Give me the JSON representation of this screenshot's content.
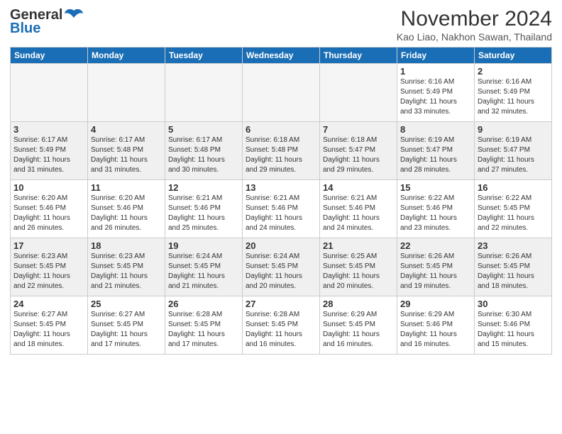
{
  "header": {
    "logo_general": "General",
    "logo_blue": "Blue",
    "month_year": "November 2024",
    "location": "Kao Liao, Nakhon Sawan, Thailand"
  },
  "weekdays": [
    "Sunday",
    "Monday",
    "Tuesday",
    "Wednesday",
    "Thursday",
    "Friday",
    "Saturday"
  ],
  "weeks": [
    {
      "shaded": false,
      "days": [
        {
          "num": "",
          "info": ""
        },
        {
          "num": "",
          "info": ""
        },
        {
          "num": "",
          "info": ""
        },
        {
          "num": "",
          "info": ""
        },
        {
          "num": "",
          "info": ""
        },
        {
          "num": "1",
          "info": "Sunrise: 6:16 AM\nSunset: 5:49 PM\nDaylight: 11 hours\nand 33 minutes."
        },
        {
          "num": "2",
          "info": "Sunrise: 6:16 AM\nSunset: 5:49 PM\nDaylight: 11 hours\nand 32 minutes."
        }
      ]
    },
    {
      "shaded": true,
      "days": [
        {
          "num": "3",
          "info": "Sunrise: 6:17 AM\nSunset: 5:49 PM\nDaylight: 11 hours\nand 31 minutes."
        },
        {
          "num": "4",
          "info": "Sunrise: 6:17 AM\nSunset: 5:48 PM\nDaylight: 11 hours\nand 31 minutes."
        },
        {
          "num": "5",
          "info": "Sunrise: 6:17 AM\nSunset: 5:48 PM\nDaylight: 11 hours\nand 30 minutes."
        },
        {
          "num": "6",
          "info": "Sunrise: 6:18 AM\nSunset: 5:48 PM\nDaylight: 11 hours\nand 29 minutes."
        },
        {
          "num": "7",
          "info": "Sunrise: 6:18 AM\nSunset: 5:47 PM\nDaylight: 11 hours\nand 29 minutes."
        },
        {
          "num": "8",
          "info": "Sunrise: 6:19 AM\nSunset: 5:47 PM\nDaylight: 11 hours\nand 28 minutes."
        },
        {
          "num": "9",
          "info": "Sunrise: 6:19 AM\nSunset: 5:47 PM\nDaylight: 11 hours\nand 27 minutes."
        }
      ]
    },
    {
      "shaded": false,
      "days": [
        {
          "num": "10",
          "info": "Sunrise: 6:20 AM\nSunset: 5:46 PM\nDaylight: 11 hours\nand 26 minutes."
        },
        {
          "num": "11",
          "info": "Sunrise: 6:20 AM\nSunset: 5:46 PM\nDaylight: 11 hours\nand 26 minutes."
        },
        {
          "num": "12",
          "info": "Sunrise: 6:21 AM\nSunset: 5:46 PM\nDaylight: 11 hours\nand 25 minutes."
        },
        {
          "num": "13",
          "info": "Sunrise: 6:21 AM\nSunset: 5:46 PM\nDaylight: 11 hours\nand 24 minutes."
        },
        {
          "num": "14",
          "info": "Sunrise: 6:21 AM\nSunset: 5:46 PM\nDaylight: 11 hours\nand 24 minutes."
        },
        {
          "num": "15",
          "info": "Sunrise: 6:22 AM\nSunset: 5:46 PM\nDaylight: 11 hours\nand 23 minutes."
        },
        {
          "num": "16",
          "info": "Sunrise: 6:22 AM\nSunset: 5:45 PM\nDaylight: 11 hours\nand 22 minutes."
        }
      ]
    },
    {
      "shaded": true,
      "days": [
        {
          "num": "17",
          "info": "Sunrise: 6:23 AM\nSunset: 5:45 PM\nDaylight: 11 hours\nand 22 minutes."
        },
        {
          "num": "18",
          "info": "Sunrise: 6:23 AM\nSunset: 5:45 PM\nDaylight: 11 hours\nand 21 minutes."
        },
        {
          "num": "19",
          "info": "Sunrise: 6:24 AM\nSunset: 5:45 PM\nDaylight: 11 hours\nand 21 minutes."
        },
        {
          "num": "20",
          "info": "Sunrise: 6:24 AM\nSunset: 5:45 PM\nDaylight: 11 hours\nand 20 minutes."
        },
        {
          "num": "21",
          "info": "Sunrise: 6:25 AM\nSunset: 5:45 PM\nDaylight: 11 hours\nand 20 minutes."
        },
        {
          "num": "22",
          "info": "Sunrise: 6:26 AM\nSunset: 5:45 PM\nDaylight: 11 hours\nand 19 minutes."
        },
        {
          "num": "23",
          "info": "Sunrise: 6:26 AM\nSunset: 5:45 PM\nDaylight: 11 hours\nand 18 minutes."
        }
      ]
    },
    {
      "shaded": false,
      "days": [
        {
          "num": "24",
          "info": "Sunrise: 6:27 AM\nSunset: 5:45 PM\nDaylight: 11 hours\nand 18 minutes."
        },
        {
          "num": "25",
          "info": "Sunrise: 6:27 AM\nSunset: 5:45 PM\nDaylight: 11 hours\nand 17 minutes."
        },
        {
          "num": "26",
          "info": "Sunrise: 6:28 AM\nSunset: 5:45 PM\nDaylight: 11 hours\nand 17 minutes."
        },
        {
          "num": "27",
          "info": "Sunrise: 6:28 AM\nSunset: 5:45 PM\nDaylight: 11 hours\nand 16 minutes."
        },
        {
          "num": "28",
          "info": "Sunrise: 6:29 AM\nSunset: 5:45 PM\nDaylight: 11 hours\nand 16 minutes."
        },
        {
          "num": "29",
          "info": "Sunrise: 6:29 AM\nSunset: 5:46 PM\nDaylight: 11 hours\nand 16 minutes."
        },
        {
          "num": "30",
          "info": "Sunrise: 6:30 AM\nSunset: 5:46 PM\nDaylight: 11 hours\nand 15 minutes."
        }
      ]
    }
  ]
}
